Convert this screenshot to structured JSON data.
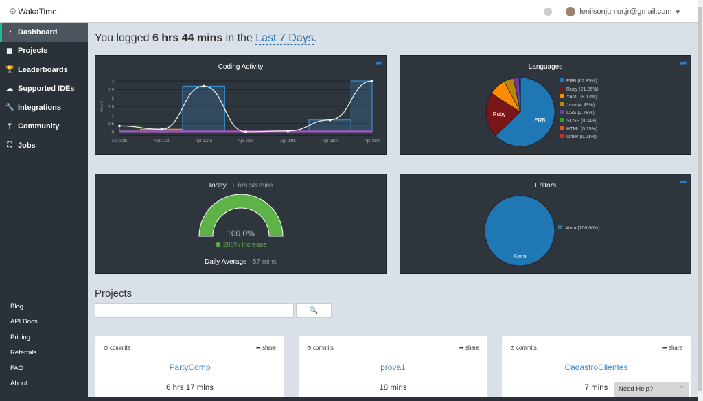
{
  "app": {
    "title": "WakaTime"
  },
  "user": {
    "email": "lenilsonjunior.jr@gmail.com"
  },
  "sidebar": {
    "items": [
      {
        "label": "Dashboard",
        "icon": "dashboard-icon"
      },
      {
        "label": "Projects",
        "icon": "grid-icon"
      },
      {
        "label": "Leaderboards",
        "icon": "trophy-icon"
      },
      {
        "label": "Supported IDEs",
        "icon": "cloud-download-icon"
      },
      {
        "label": "Integrations",
        "icon": "wrench-icon"
      },
      {
        "label": "Community",
        "icon": "fork-icon"
      },
      {
        "label": "Jobs",
        "icon": "binoculars-icon"
      }
    ],
    "footer": [
      "Blog",
      "API Docs",
      "Pricing",
      "Referrals",
      "FAQ",
      "About"
    ]
  },
  "header": {
    "prefix": "You logged ",
    "total": "6 hrs 44 mins",
    "mid": " in the ",
    "range": "Last 7 Days",
    "suffix": "."
  },
  "today": {
    "label": "Today",
    "value": "2 hrs 58 mins",
    "percent": "100.0%",
    "increase": "208% Increase",
    "avg_label": "Daily Average",
    "avg_value": "57 mins",
    "gauge_fraction": 1.0,
    "color": "#5db346"
  },
  "projects": {
    "title": "Projects",
    "search_placeholder": "",
    "cards": [
      {
        "commits": "commits",
        "share": "share",
        "name": "PartyComp",
        "time": "6 hrs 17 mins"
      },
      {
        "commits": "commits",
        "share": "share",
        "name": "prova1",
        "time": "18 mins"
      },
      {
        "commits": "commits",
        "share": "share",
        "name": "CadastroClientes",
        "time": "7 mins"
      }
    ]
  },
  "help": {
    "label": "Need Help?"
  },
  "chart_data": [
    {
      "type": "bar",
      "title": "Coding Activity",
      "ylabel": "Hours",
      "ylim": [
        0,
        3
      ],
      "yticks": [
        "0",
        "0.5",
        "1",
        "1.5",
        "2",
        "2.5",
        "3"
      ],
      "categories": [
        "Apr 20th",
        "Apr 21st",
        "Apr 22nd",
        "Apr 23rd",
        "Apr 24th",
        "Apr 25th",
        "Apr 26th"
      ],
      "total": [
        0.35,
        0.15,
        2.7,
        0,
        0.05,
        0.7,
        3.0
      ],
      "series": [
        {
          "color": "#2ea02c",
          "values": [
            0.35,
            0,
            0,
            0,
            0,
            0,
            0
          ]
        },
        {
          "color": "#e8994a",
          "values": [
            0,
            0.15,
            0,
            0,
            0,
            0,
            0
          ]
        },
        {
          "color": "#3a8cc8",
          "values": [
            0,
            0,
            2.7,
            0,
            0,
            0.7,
            3.0
          ]
        },
        {
          "color": "#9b59b6",
          "values": [
            0.05,
            0.05,
            0.05,
            0.05,
            0.05,
            0.05,
            0.05
          ]
        }
      ]
    },
    {
      "type": "pie",
      "title": "Languages",
      "labels": [
        "ERB",
        "Ruby",
        "YAML",
        "Java",
        "CSS",
        "SCSS",
        "HTML",
        "Other"
      ],
      "values": [
        62.85,
        21.26,
        8.13,
        4.49,
        2.78,
        0.34,
        0.15,
        0.01
      ],
      "legend": [
        "ERB (62.85%)",
        "Ruby (21.26%)",
        "YAML (8.13%)",
        "Java (4.49%)",
        "CSS (2.78%)",
        "SCSS (0.34%)",
        "HTML (0.15%)",
        "Other (0.01%)"
      ],
      "colors": [
        "#1f77b4",
        "#7a1618",
        "#ff8c00",
        "#b8860b",
        "#6a3d9a",
        "#2ca02c",
        "#e8552b",
        "#d62728"
      ],
      "legend_position": "right"
    },
    {
      "type": "pie",
      "title": "Editors",
      "labels": [
        "Atom"
      ],
      "values": [
        100.0
      ],
      "legend": [
        "Atom (100.00%)"
      ],
      "colors": [
        "#1f77b4"
      ],
      "legend_position": "right"
    }
  ]
}
